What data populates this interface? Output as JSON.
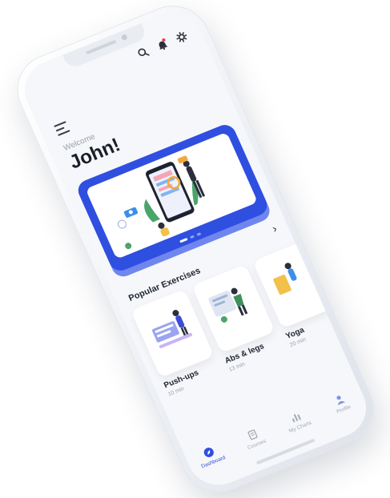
{
  "header": {
    "icons": [
      "search-icon",
      "bell-icon",
      "gear-icon"
    ],
    "menu_icon": "menu-icon"
  },
  "greeting": {
    "welcome": "Welcome",
    "name": "John!"
  },
  "banner": {
    "color": "#2f4fe0",
    "slides": 3,
    "active_slide": 0
  },
  "popular": {
    "title": "Popular Exercises",
    "next_icon": "chevron-right-icon",
    "items": [
      {
        "title": "Push-ups",
        "meta": "10 min"
      },
      {
        "title": "Abs & legs",
        "meta": "13 min"
      },
      {
        "title": "Yoga",
        "meta": "20 min"
      }
    ]
  },
  "nav": {
    "items": [
      {
        "label": "Dashboard",
        "icon": "compass-icon",
        "active": true
      },
      {
        "label": "Courses",
        "icon": "book-icon",
        "active": false
      },
      {
        "label": "My Charts",
        "icon": "bar-chart-icon",
        "active": false
      },
      {
        "label": "Profile",
        "icon": "user-icon",
        "active": false
      }
    ]
  },
  "colors": {
    "accent": "#2f4fe0",
    "text_dark": "#1b1f29",
    "text_muted": "#9aa1ad",
    "notification_dot": "#e53950"
  }
}
